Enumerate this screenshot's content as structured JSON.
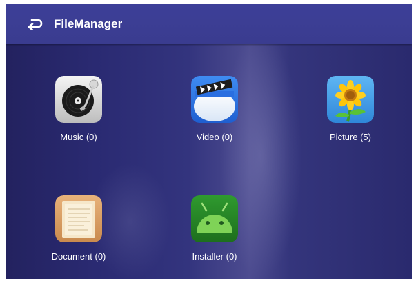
{
  "app": {
    "title": "FileManager"
  },
  "header": {
    "back_icon": "back-arrow-icon"
  },
  "categories": [
    {
      "label": "Music (0)",
      "icon": "music-turntable-icon"
    },
    {
      "label": "Video (0)",
      "icon": "video-clapper-icon"
    },
    {
      "label": "Picture (5)",
      "icon": "sunflower-picture-icon"
    },
    {
      "label": "Document (0)",
      "icon": "document-icon"
    },
    {
      "label": "Installer (0)",
      "icon": "android-installer-icon"
    }
  ],
  "colors": {
    "header_bg": "#3d3f98",
    "body_bg": "#2a2a72",
    "text": "#ffffff"
  }
}
